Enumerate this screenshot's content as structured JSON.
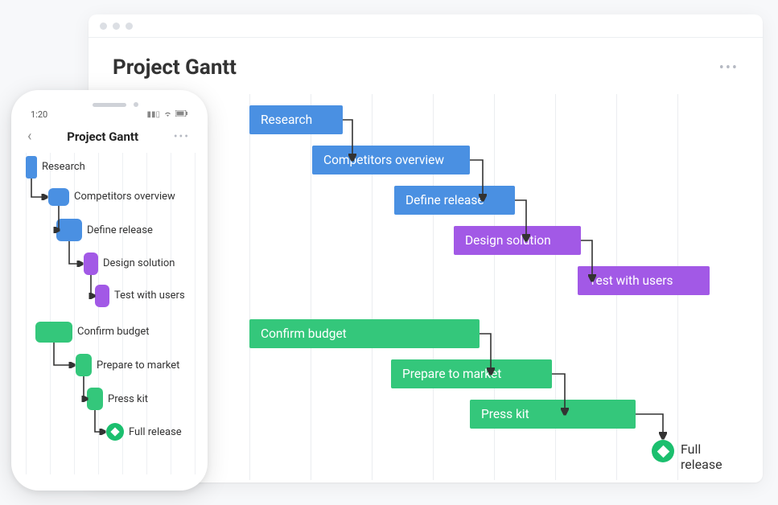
{
  "chart_data": {
    "type": "gantt",
    "tasks": [
      {
        "id": "research",
        "label": "Research",
        "track": 0,
        "start": 0,
        "end": 1.2,
        "color": "blue",
        "depends_on": null
      },
      {
        "id": "competitors",
        "label": "Competitors overview",
        "track": 1,
        "start": 1.2,
        "end": 3.4,
        "color": "blue",
        "depends_on": "research"
      },
      {
        "id": "define_release",
        "label": "Define release",
        "track": 2,
        "start": 2.8,
        "end": 4.4,
        "color": "blue",
        "depends_on": "competitors"
      },
      {
        "id": "design_solution",
        "label": "Design solution",
        "track": 3,
        "start": 3.8,
        "end": 5.4,
        "color": "purple",
        "depends_on": "define_release"
      },
      {
        "id": "test_users",
        "label": "Test with users",
        "track": 4,
        "start": 5.4,
        "end": 7.0,
        "color": "purple",
        "depends_on": "design_solution"
      },
      {
        "id": "confirm_budget",
        "label": "Confirm budget",
        "track": 5,
        "start": 0,
        "end": 3.2,
        "color": "green",
        "depends_on": null
      },
      {
        "id": "prepare_market",
        "label": "Prepare to market",
        "track": 6,
        "start": 2.6,
        "end": 5.0,
        "color": "green",
        "depends_on": "confirm_budget"
      },
      {
        "id": "press_kit",
        "label": "Press kit",
        "track": 7,
        "start": 4.0,
        "end": 6.2,
        "color": "green",
        "depends_on": "prepare_market"
      },
      {
        "id": "full_release",
        "label": "Full release",
        "track": 8,
        "start": 6.0,
        "end": 6.0,
        "color": "green",
        "depends_on": "press_kit",
        "milestone": true
      }
    ],
    "columns": 8,
    "title": "Project Gantt"
  },
  "desktop": {
    "title": "Project Gantt",
    "tasks": {
      "research": "Research",
      "competitors": "Competitors overview",
      "define_release": "Define release",
      "design_solution": "Design solution",
      "test_users": "Test with users",
      "confirm_budget": "Confirm budget",
      "prepare_market": "Prepare to market",
      "press_kit": "Press kit",
      "full_release": "Full release"
    }
  },
  "phone": {
    "status_time": "1:20",
    "title": "Project Gantt",
    "tasks": {
      "research": "Research",
      "competitors": "Competitors overview",
      "define_release": "Define release",
      "design_solution": "Design solution",
      "test_users": "Test with users",
      "confirm_budget": "Confirm budget",
      "prepare_market": "Prepare to market",
      "press_kit": "Press kit",
      "full_release": "Full release"
    }
  },
  "colors": {
    "blue": "#4a90e2",
    "purple": "#a259e6",
    "green": "#34c77b"
  }
}
